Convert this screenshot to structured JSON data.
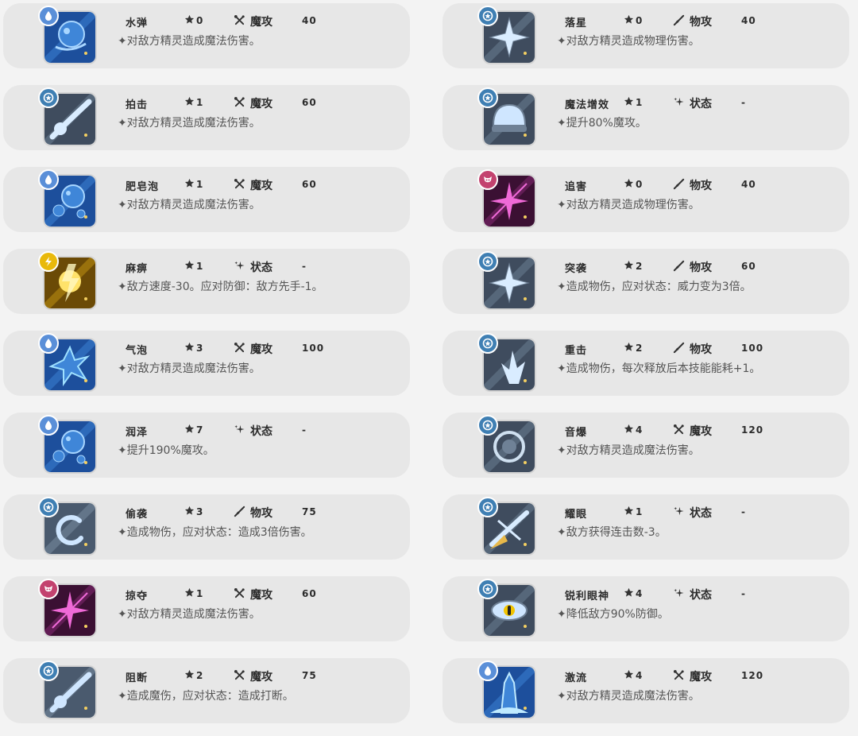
{
  "colors": {
    "water": "#5a8fd8",
    "normal": "#3f7fb3",
    "electric": "#e9b90b",
    "shadow": "#c3426f"
  },
  "skills": [
    {
      "name": "水弹",
      "cost": "0",
      "type_label": "魔攻",
      "type_icon": "magic-icon",
      "power": "40",
      "desc": "✦对敌方精灵造成魔法伤害。",
      "element": "water",
      "art": "water"
    },
    {
      "name": "落星",
      "cost": "0",
      "type_label": "物攻",
      "type_icon": "physical-icon",
      "power": "40",
      "desc": "✦对敌方精灵造成物理伤害。",
      "element": "normal",
      "art": "star"
    },
    {
      "name": "拍击",
      "cost": "1",
      "type_label": "魔攻",
      "type_icon": "magic-icon",
      "power": "60",
      "desc": "✦对敌方精灵造成魔法伤害。",
      "element": "normal",
      "art": "streak"
    },
    {
      "name": "魔法增效",
      "cost": "1",
      "type_label": "状态",
      "type_icon": "status-icon",
      "power": "-",
      "desc": "✦提升80%魔攻。",
      "element": "normal",
      "art": "helmet"
    },
    {
      "name": "肥皂泡",
      "cost": "1",
      "type_label": "魔攻",
      "type_icon": "magic-icon",
      "power": "60",
      "desc": "✦对敌方精灵造成魔法伤害。",
      "element": "water",
      "art": "bubbles"
    },
    {
      "name": "追害",
      "cost": "0",
      "type_label": "物攻",
      "type_icon": "physical-icon",
      "power": "40",
      "desc": "✦对敌方精灵造成物理伤害。",
      "element": "shadow",
      "art": "shadow"
    },
    {
      "name": "麻痹",
      "cost": "1",
      "type_label": "状态",
      "type_icon": "status-icon",
      "power": "-",
      "desc": "✦敌方速度-30。应对防御：敌方先手-1。",
      "element": "electric",
      "art": "electric"
    },
    {
      "name": "突袭",
      "cost": "2",
      "type_label": "物攻",
      "type_icon": "physical-icon",
      "power": "60",
      "desc": "✦造成物伤，应对状态：威力变为3倍。",
      "element": "normal",
      "art": "sparkle"
    },
    {
      "name": "气泡",
      "cost": "3",
      "type_label": "魔攻",
      "type_icon": "magic-icon",
      "power": "100",
      "desc": "✦对敌方精灵造成魔法伤害。",
      "element": "water",
      "art": "splash"
    },
    {
      "name": "重击",
      "cost": "2",
      "type_label": "物攻",
      "type_icon": "physical-icon",
      "power": "100",
      "desc": "✦造成物伤，每次释放后本技能能耗+1。",
      "element": "normal",
      "art": "impact"
    },
    {
      "name": "润泽",
      "cost": "7",
      "type_label": "状态",
      "type_icon": "status-icon",
      "power": "-",
      "desc": "✦提升190%魔攻。",
      "element": "water",
      "art": "drops"
    },
    {
      "name": "音爆",
      "cost": "4",
      "type_label": "魔攻",
      "type_icon": "magic-icon",
      "power": "120",
      "desc": "✦对敌方精灵造成魔法伤害。",
      "element": "normal",
      "art": "ring"
    },
    {
      "name": "偷袭",
      "cost": "3",
      "type_label": "物攻",
      "type_icon": "physical-icon",
      "power": "75",
      "desc": "✦造成物伤，应对状态：造成3倍伤害。",
      "element": "normal",
      "art": "swirl"
    },
    {
      "name": "耀眼",
      "cost": "1",
      "type_label": "状态",
      "type_icon": "status-icon",
      "power": "-",
      "desc": "✦敌方获得连击数-3。",
      "element": "normal",
      "art": "flash"
    },
    {
      "name": "掠夺",
      "cost": "1",
      "type_label": "魔攻",
      "type_icon": "magic-icon",
      "power": "60",
      "desc": "✦对敌方精灵造成魔法伤害。",
      "element": "shadow",
      "art": "shadow"
    },
    {
      "name": "锐利眼神",
      "cost": "4",
      "type_label": "状态",
      "type_icon": "status-icon",
      "power": "-",
      "desc": "✦降低敌方90%防御。",
      "element": "normal",
      "art": "eye"
    },
    {
      "name": "阻断",
      "cost": "2",
      "type_label": "魔攻",
      "type_icon": "magic-icon",
      "power": "75",
      "desc": "✦造成魔伤，应对状态：造成打断。",
      "element": "normal",
      "art": "comet"
    },
    {
      "name": "激流",
      "cost": "4",
      "type_label": "魔攻",
      "type_icon": "magic-icon",
      "power": "120",
      "desc": "✦对敌方精灵造成魔法伤害。",
      "element": "water",
      "art": "geyser"
    }
  ]
}
